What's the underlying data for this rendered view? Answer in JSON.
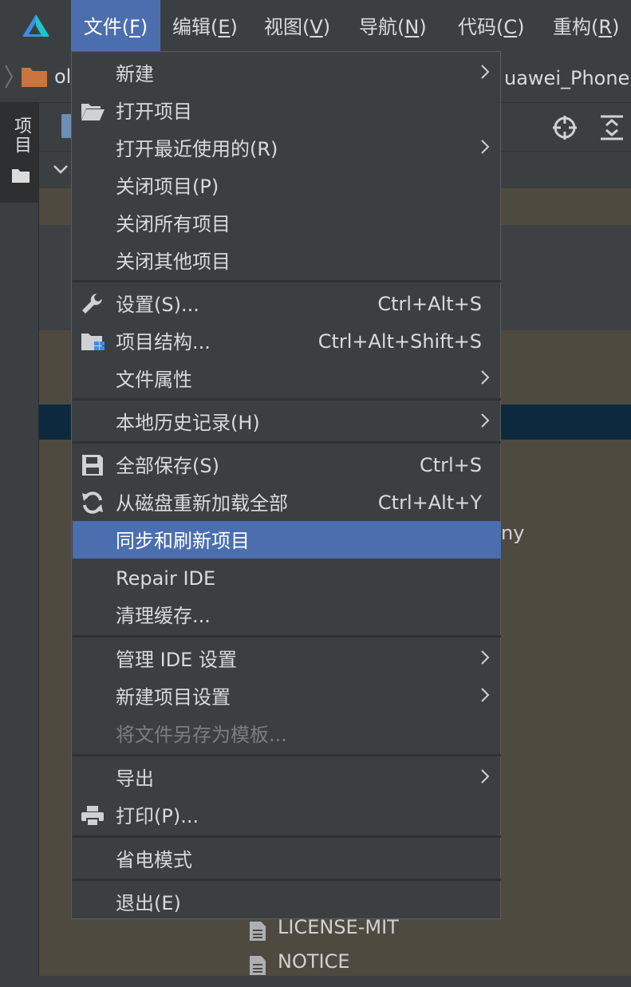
{
  "menubar": {
    "items": [
      {
        "label": "文件(",
        "mnem": "F",
        "end": ")",
        "active": true
      },
      {
        "label": "编辑(",
        "mnem": "E",
        "end": ")"
      },
      {
        "label": "视图(",
        "mnem": "V",
        "end": ")"
      },
      {
        "label": "导航(",
        "mnem": "N",
        "end": ")"
      },
      {
        "label": "代码(",
        "mnem": "C",
        "end": ")"
      },
      {
        "label": "重构(",
        "mnem": "R",
        "end": ")"
      }
    ]
  },
  "navbar": {
    "folder_text": "ol",
    "device_text": "uawei_Phone"
  },
  "sidebar": {
    "project_tab_label": "项目"
  },
  "behind_text": "ny",
  "tree_files": [
    {
      "label": "LICENSE-MIT"
    },
    {
      "label": "NOTICE"
    }
  ],
  "file_menu": {
    "items": [
      {
        "label": "新建",
        "submenu": true
      },
      {
        "label": "打开项目",
        "icon": "open-folder-icon"
      },
      {
        "label": "打开最近使用的(R)",
        "submenu": true
      },
      {
        "label": "关闭项目(P)"
      },
      {
        "label": "关闭所有项目"
      },
      {
        "label": "关闭其他项目"
      },
      {
        "label": "设置(S)...",
        "shortcut": "Ctrl+Alt+S",
        "icon": "wrench-icon"
      },
      {
        "label": "项目结构...",
        "shortcut": "Ctrl+Alt+Shift+S",
        "icon": "project-structure-icon"
      },
      {
        "label": "文件属性",
        "submenu": true
      },
      {
        "label": "本地历史记录(H)",
        "submenu": true
      },
      {
        "label": "全部保存(S)",
        "shortcut": "Ctrl+S",
        "icon": "save-icon"
      },
      {
        "label": "从磁盘重新加载全部",
        "shortcut": "Ctrl+Alt+Y",
        "icon": "reload-icon"
      },
      {
        "label": "同步和刷新项目",
        "highlighted": true
      },
      {
        "label": "Repair IDE"
      },
      {
        "label": "清理缓存..."
      },
      {
        "label": "管理 IDE 设置",
        "submenu": true
      },
      {
        "label": "新建项目设置",
        "submenu": true
      },
      {
        "label": "将文件另存为模板...",
        "disabled": true
      },
      {
        "label": "导出",
        "submenu": true
      },
      {
        "label": "打印(P)...",
        "icon": "printer-icon"
      },
      {
        "label": "省电模式"
      },
      {
        "label": "退出(E)"
      }
    ]
  }
}
